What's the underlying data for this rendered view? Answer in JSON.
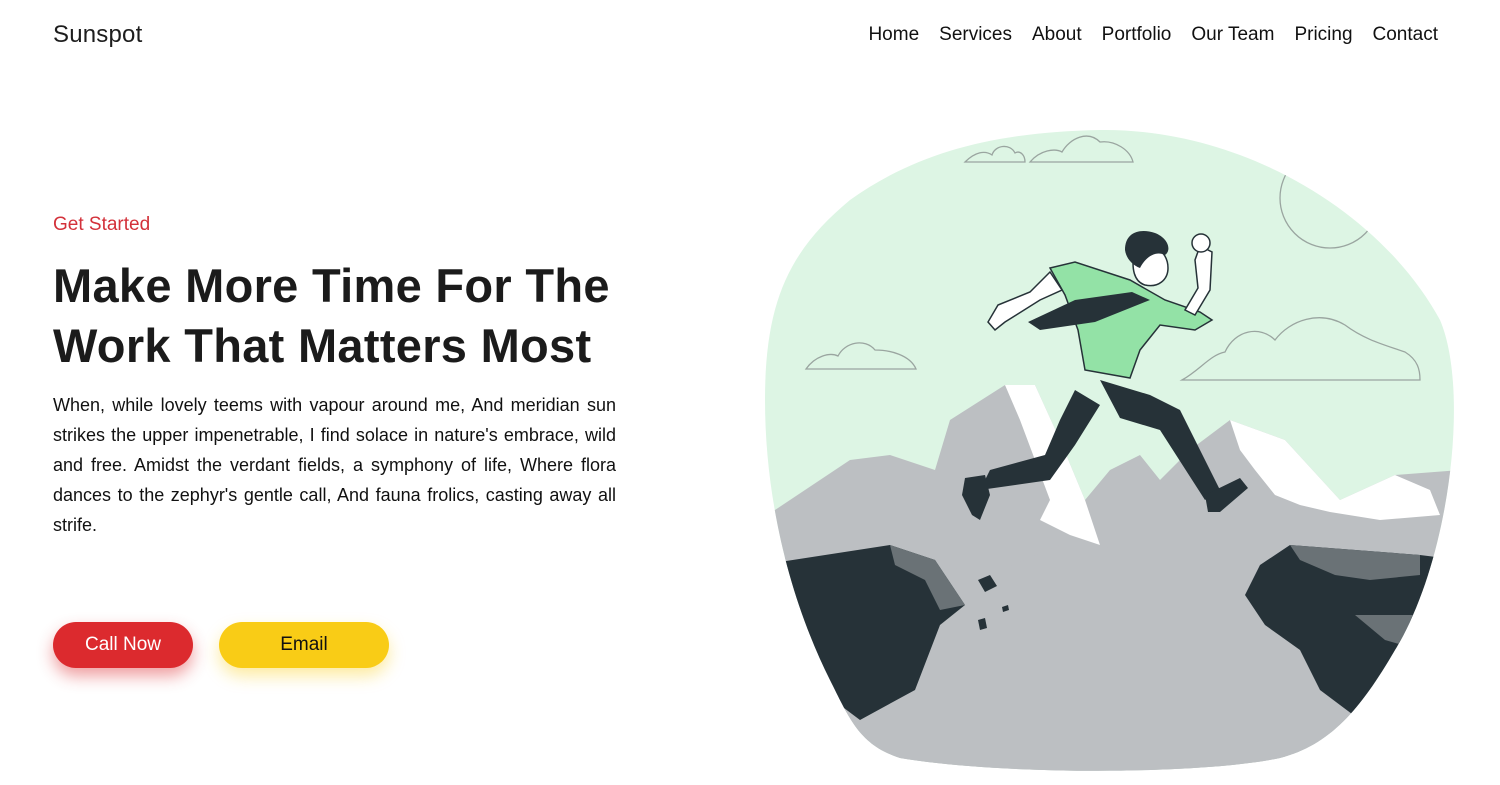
{
  "nav": {
    "brand": "Sunspot",
    "links": [
      "Home",
      "Services",
      "About",
      "Portfolio",
      "Our Team",
      "Pricing",
      "Contact"
    ]
  },
  "hero": {
    "eyebrow": "Get Started",
    "headline": "Make More Time For The Work That Matters Most",
    "body": "When, while lovely teems with vapour around me, And meridian sun strikes the upper impenetrable, I find solace in nature's embrace, wild and free. Amidst the verdant fields, a symphony of life, Where flora dances to the zephyr's gentle call, And fauna frolics, casting away all strife.",
    "buttons": {
      "call": "Call Now",
      "email": "Email"
    }
  },
  "illustration": {
    "icon": "man-leaping-between-cliffs-illustration",
    "colors": {
      "sky": "#ddf5e4",
      "rock": "#bcbfc2",
      "rock_dark": "#263238",
      "shirt": "#93e2a6",
      "outline": "#263238"
    }
  },
  "colors": {
    "accent_red": "#dc2a2e",
    "accent_yellow": "#f9cc16",
    "eyebrow": "#d3313a"
  }
}
